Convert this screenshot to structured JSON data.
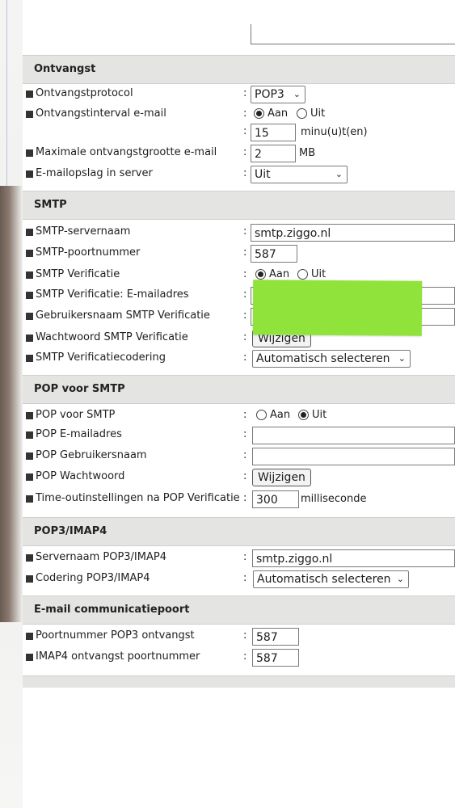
{
  "sections": {
    "ontvangst": "Ontvangst",
    "smtp": "SMTP",
    "pop_voor_smtp": "POP voor SMTP",
    "pop3_imap4": "POP3/IMAP4",
    "email_communicatiepoort": "E-mail communicatiepoort"
  },
  "ontvangst": {
    "protocol_label": "Ontvangstprotocol",
    "protocol_value": "POP3",
    "interval_label": "Ontvangstinterval e-mail",
    "radio_on": "Aan",
    "radio_off": "Uit",
    "interval_minutes": "15",
    "interval_unit": "minu(u)t(en)",
    "max_size_label": "Maximale ontvangstgrootte e-mail",
    "max_size_value": "2",
    "max_size_unit": "MB",
    "storage_label": "E-mailopslag in server",
    "storage_value": "Uit"
  },
  "smtp": {
    "server_label": "SMTP-servernaam",
    "server_value": "smtp.ziggo.nl",
    "port_label": "SMTP-poortnummer",
    "port_value": "587",
    "verification_label": "SMTP Verificatie",
    "radio_on": "Aan",
    "radio_off": "Uit",
    "verif_email_label": "SMTP Verificatie: E-mailadres",
    "verif_user_label": "Gebruikersnaam SMTP Verificatie",
    "verif_password_label": "Wachtwoord SMTP Verificatie",
    "change_button": "Wijzigen",
    "encoding_label": "SMTP Verificatiecodering",
    "encoding_value": "Automatisch selecteren"
  },
  "pop_smtp": {
    "pop_label": "POP voor SMTP",
    "radio_on": "Aan",
    "radio_off": "Uit",
    "email_label": "POP E-mailadres",
    "user_label": "POP Gebruikersnaam",
    "password_label": "POP Wachtwoord",
    "change_button": "Wijzigen",
    "timeout_label": "Time-outinstellingen na POP Verificatie",
    "timeout_value": "300",
    "timeout_unit": "milliseconde"
  },
  "pop3_imap4": {
    "server_label": "Servernaam POP3/IMAP4",
    "server_value": "smtp.ziggo.nl",
    "encoding_label": "Codering POP3/IMAP4",
    "encoding_value": "Automatisch selecteren"
  },
  "port": {
    "pop3_label": "Poortnummer POP3 ontvangst",
    "pop3_value": "587",
    "imap4_label": "IMAP4 ontvangst poortnummer",
    "imap4_value": "587"
  },
  "colors": {
    "section_bg": "#e4e4e2",
    "sticky_note": "#8fe33a"
  }
}
